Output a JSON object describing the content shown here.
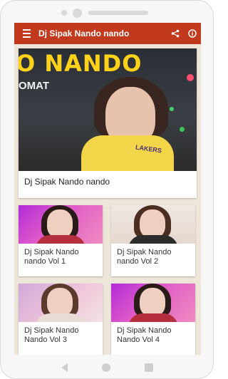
{
  "app": {
    "title": "Dj Sipak Nando nando",
    "accent_color": "#c13a1d",
    "icons": [
      "menu-icon",
      "share-icon",
      "info-icon"
    ]
  },
  "hero": {
    "banner_text": "O NANDO",
    "sub_text": "OMAT",
    "jersey_text": "LAKERS",
    "caption": "Dj Sipak Nando nando"
  },
  "tiles": [
    {
      "caption": "Dj Sipak Nando nando Vol 1"
    },
    {
      "caption": "Dj Sipak Nando nando Vol 2"
    },
    {
      "caption": "Dj Sipak Nando Nando Vol 3"
    },
    {
      "caption": "Dj Sipak Nando Nando Vol 4"
    }
  ],
  "system_nav": [
    "back-icon",
    "home-icon",
    "recents-icon"
  ]
}
